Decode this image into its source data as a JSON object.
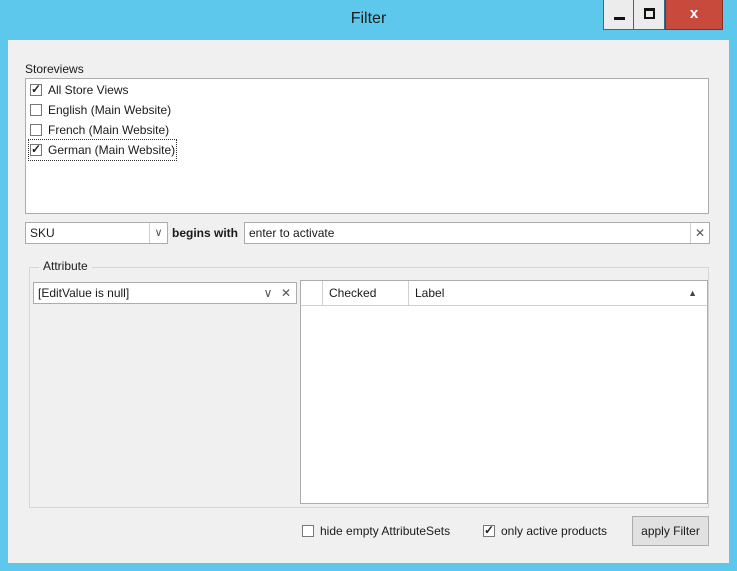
{
  "window": {
    "title": "Filter",
    "close_glyph": "x"
  },
  "storeviews": {
    "label": "Storeviews",
    "items": [
      {
        "label": "All Store Views",
        "checked": true
      },
      {
        "label": "English (Main Website)",
        "checked": false
      },
      {
        "label": "French (Main Website)",
        "checked": false
      },
      {
        "label": "German (Main Website)",
        "checked": true
      }
    ]
  },
  "sku_filter": {
    "field_value": "SKU",
    "operator_label": "begins with",
    "value_placeholder": "enter to activate"
  },
  "attribute": {
    "group_title": "Attribute",
    "selector_value": "[EditValue is null]",
    "columns": [
      "Checked",
      "Label"
    ]
  },
  "footer": {
    "hide_empty_label": "hide empty AttributeSets",
    "hide_empty_checked": false,
    "only_active_label": "only active products",
    "only_active_checked": true,
    "apply_label": "apply Filter"
  },
  "glyphs": {
    "check": "✓",
    "dropdown": "∨",
    "clear": "✕",
    "sort_up": "▲"
  },
  "colors": {
    "title_bar": "#5ec8ec",
    "close_button": "#c74a3d",
    "client_bg": "#f0f0f0"
  }
}
